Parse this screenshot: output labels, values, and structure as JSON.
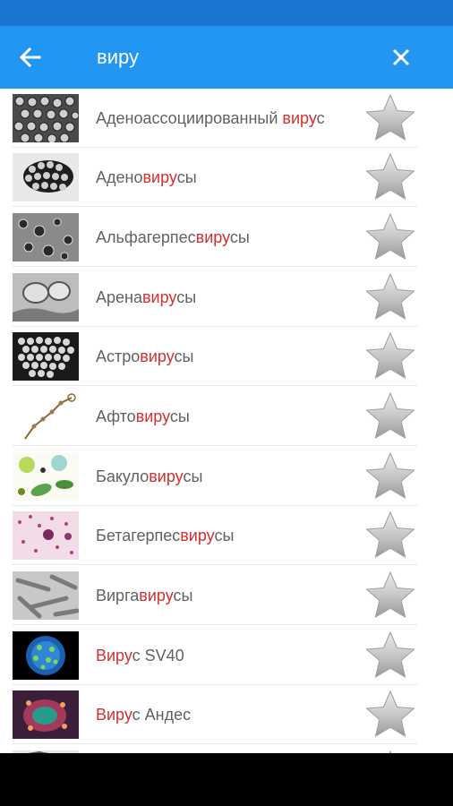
{
  "toolbar": {
    "search_text": "виру",
    "back_icon": "arrow-left-icon",
    "close_icon": "close-icon",
    "color": "#2196f3",
    "status_color": "#1b76d2"
  },
  "highlight_color": "#d32f2f",
  "results": [
    {
      "pre": "Аденоассоциированный ",
      "match": "виру",
      "post": "с"
    },
    {
      "pre": "Адено",
      "match": "виру",
      "post": "сы"
    },
    {
      "pre": "Альфагерпес",
      "match": "виру",
      "post": "сы"
    },
    {
      "pre": "Арена",
      "match": "виру",
      "post": "сы"
    },
    {
      "pre": "Астро",
      "match": "виру",
      "post": "сы"
    },
    {
      "pre": "Афто",
      "match": "виру",
      "post": "сы"
    },
    {
      "pre": "Бакуло",
      "match": "виру",
      "post": "сы"
    },
    {
      "pre": "Бетагерпес",
      "match": "виру",
      "post": "сы"
    },
    {
      "pre": "Вирга",
      "match": "виру",
      "post": "сы"
    },
    {
      "pre": "",
      "match": "Виру",
      "post": "с SV40"
    },
    {
      "pre": "",
      "match": "Виру",
      "post": "с Андес"
    },
    {
      "pre": "",
      "match": "",
      "post": ""
    }
  ],
  "favorite_icon": "star-icon"
}
